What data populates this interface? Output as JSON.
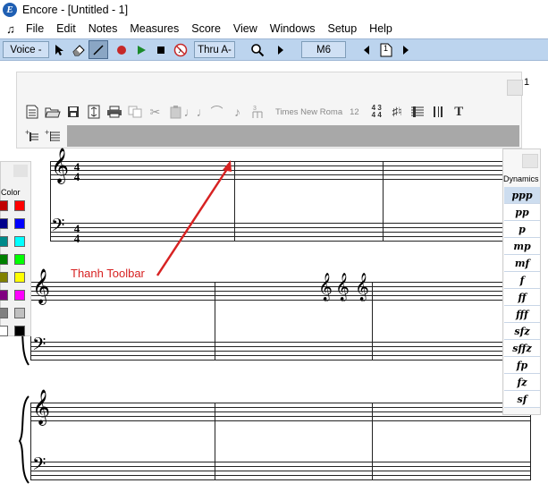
{
  "window": {
    "title": "Encore - [Untitled - 1]",
    "logo_letter": "E"
  },
  "menu": {
    "items": [
      "File",
      "Edit",
      "Notes",
      "Measures",
      "Score",
      "View",
      "Windows",
      "Setup",
      "Help"
    ]
  },
  "toolbar": {
    "voice_label": "Voice -",
    "thru_label": "Thru A-",
    "measure_label": "M6",
    "page_label": "1"
  },
  "floating_toolbar": {
    "font_name": "Times New Roma",
    "font_size": "12",
    "timesig_top": "4 3",
    "timesig_bottom": "4 4",
    "page_number": "1"
  },
  "color_panel": {
    "title": "Color",
    "swatches": [
      "#c00000",
      "#ff0000",
      "#00008b",
      "#0000ff",
      "#008b8b",
      "#00ffff",
      "#008000",
      "#00ff00",
      "#808000",
      "#ffff00",
      "#800080",
      "#ff00ff",
      "#808080",
      "#c0c0c0",
      "#ffffff",
      "#000000"
    ]
  },
  "dynamics_panel": {
    "title": "Dynamics",
    "items": [
      "ppp",
      "pp",
      "p",
      "mp",
      "mf",
      "f",
      "ff",
      "fff",
      "sfz",
      "sffz",
      "fp",
      "fz",
      "sf"
    ]
  },
  "annotation": {
    "label": "Thanh Toolbar",
    "color": "#d72222"
  }
}
